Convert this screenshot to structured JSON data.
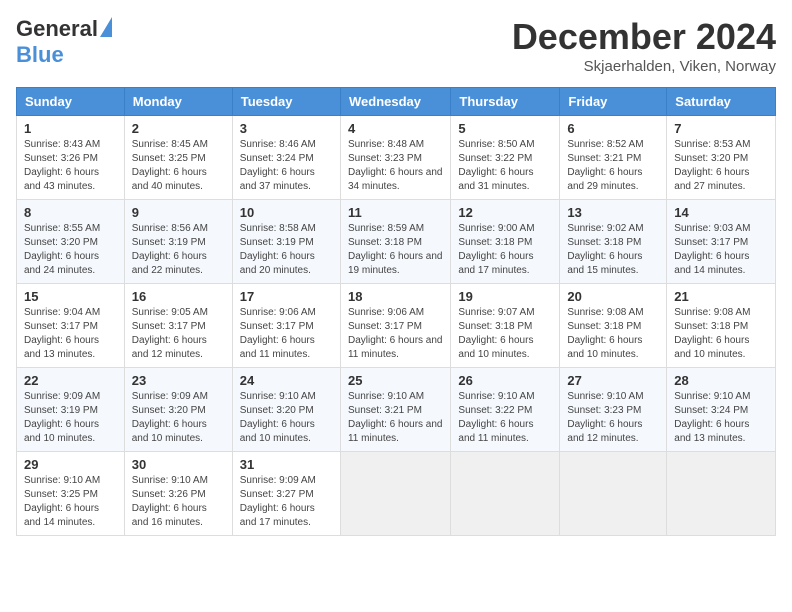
{
  "logo": {
    "general": "General",
    "blue": "Blue"
  },
  "title": "December 2024",
  "location": "Skjaerhalden, Viken, Norway",
  "days_header": [
    "Sunday",
    "Monday",
    "Tuesday",
    "Wednesday",
    "Thursday",
    "Friday",
    "Saturday"
  ],
  "weeks": [
    [
      {
        "day": "1",
        "sunrise": "8:43 AM",
        "sunset": "3:26 PM",
        "daylight": "6 hours and 43 minutes."
      },
      {
        "day": "2",
        "sunrise": "8:45 AM",
        "sunset": "3:25 PM",
        "daylight": "6 hours and 40 minutes."
      },
      {
        "day": "3",
        "sunrise": "8:46 AM",
        "sunset": "3:24 PM",
        "daylight": "6 hours and 37 minutes."
      },
      {
        "day": "4",
        "sunrise": "8:48 AM",
        "sunset": "3:23 PM",
        "daylight": "6 hours and 34 minutes."
      },
      {
        "day": "5",
        "sunrise": "8:50 AM",
        "sunset": "3:22 PM",
        "daylight": "6 hours and 31 minutes."
      },
      {
        "day": "6",
        "sunrise": "8:52 AM",
        "sunset": "3:21 PM",
        "daylight": "6 hours and 29 minutes."
      },
      {
        "day": "7",
        "sunrise": "8:53 AM",
        "sunset": "3:20 PM",
        "daylight": "6 hours and 27 minutes."
      }
    ],
    [
      {
        "day": "8",
        "sunrise": "8:55 AM",
        "sunset": "3:20 PM",
        "daylight": "6 hours and 24 minutes."
      },
      {
        "day": "9",
        "sunrise": "8:56 AM",
        "sunset": "3:19 PM",
        "daylight": "6 hours and 22 minutes."
      },
      {
        "day": "10",
        "sunrise": "8:58 AM",
        "sunset": "3:19 PM",
        "daylight": "6 hours and 20 minutes."
      },
      {
        "day": "11",
        "sunrise": "8:59 AM",
        "sunset": "3:18 PM",
        "daylight": "6 hours and 19 minutes."
      },
      {
        "day": "12",
        "sunrise": "9:00 AM",
        "sunset": "3:18 PM",
        "daylight": "6 hours and 17 minutes."
      },
      {
        "day": "13",
        "sunrise": "9:02 AM",
        "sunset": "3:18 PM",
        "daylight": "6 hours and 15 minutes."
      },
      {
        "day": "14",
        "sunrise": "9:03 AM",
        "sunset": "3:17 PM",
        "daylight": "6 hours and 14 minutes."
      }
    ],
    [
      {
        "day": "15",
        "sunrise": "9:04 AM",
        "sunset": "3:17 PM",
        "daylight": "6 hours and 13 minutes."
      },
      {
        "day": "16",
        "sunrise": "9:05 AM",
        "sunset": "3:17 PM",
        "daylight": "6 hours and 12 minutes."
      },
      {
        "day": "17",
        "sunrise": "9:06 AM",
        "sunset": "3:17 PM",
        "daylight": "6 hours and 11 minutes."
      },
      {
        "day": "18",
        "sunrise": "9:06 AM",
        "sunset": "3:17 PM",
        "daylight": "6 hours and 11 minutes."
      },
      {
        "day": "19",
        "sunrise": "9:07 AM",
        "sunset": "3:18 PM",
        "daylight": "6 hours and 10 minutes."
      },
      {
        "day": "20",
        "sunrise": "9:08 AM",
        "sunset": "3:18 PM",
        "daylight": "6 hours and 10 minutes."
      },
      {
        "day": "21",
        "sunrise": "9:08 AM",
        "sunset": "3:18 PM",
        "daylight": "6 hours and 10 minutes."
      }
    ],
    [
      {
        "day": "22",
        "sunrise": "9:09 AM",
        "sunset": "3:19 PM",
        "daylight": "6 hours and 10 minutes."
      },
      {
        "day": "23",
        "sunrise": "9:09 AM",
        "sunset": "3:20 PM",
        "daylight": "6 hours and 10 minutes."
      },
      {
        "day": "24",
        "sunrise": "9:10 AM",
        "sunset": "3:20 PM",
        "daylight": "6 hours and 10 minutes."
      },
      {
        "day": "25",
        "sunrise": "9:10 AM",
        "sunset": "3:21 PM",
        "daylight": "6 hours and 11 minutes."
      },
      {
        "day": "26",
        "sunrise": "9:10 AM",
        "sunset": "3:22 PM",
        "daylight": "6 hours and 11 minutes."
      },
      {
        "day": "27",
        "sunrise": "9:10 AM",
        "sunset": "3:23 PM",
        "daylight": "6 hours and 12 minutes."
      },
      {
        "day": "28",
        "sunrise": "9:10 AM",
        "sunset": "3:24 PM",
        "daylight": "6 hours and 13 minutes."
      }
    ],
    [
      {
        "day": "29",
        "sunrise": "9:10 AM",
        "sunset": "3:25 PM",
        "daylight": "6 hours and 14 minutes."
      },
      {
        "day": "30",
        "sunrise": "9:10 AM",
        "sunset": "3:26 PM",
        "daylight": "6 hours and 16 minutes."
      },
      {
        "day": "31",
        "sunrise": "9:09 AM",
        "sunset": "3:27 PM",
        "daylight": "6 hours and 17 minutes."
      },
      null,
      null,
      null,
      null
    ]
  ],
  "labels": {
    "sunrise": "Sunrise:",
    "sunset": "Sunset:",
    "daylight": "Daylight:"
  }
}
